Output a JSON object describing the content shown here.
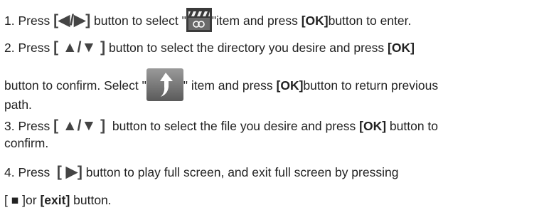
{
  "step1": {
    "prefix": "1. Press ",
    "key": "[◀/▶]",
    "mid": " button to select \"",
    "icon": "clapperboard-icon",
    "after_icon": "\"item and press ",
    "ok": "[OK]",
    "suffix": "button to enter."
  },
  "step2": {
    "prefix": "2. Press ",
    "key": "[ ▲/▼ ]",
    "mid": " button to select the directory you desire and press ",
    "ok": "[OK]",
    "line2_a": "button to confirm. Select \"",
    "icon": "return-arrow-icon",
    "line2_b": "\" item and press ",
    "ok2": "[OK]",
    "line2_c": "button to return previous",
    "line3": "path."
  },
  "step3": {
    "prefix": "3. Press ",
    "key": "[ ▲/▼ ]",
    "mid": "  button to select the file you desire and press ",
    "ok": "[OK]",
    "suffix": " button to",
    "line2": "confirm."
  },
  "step4": {
    "prefix": "4. Press  ",
    "key": "[ ▶]",
    "mid": " button to play full screen, and exit full screen by pressing",
    "key2": "[ ■ ]",
    "or": "or ",
    "exit": "[exit]",
    "suffix": " button."
  }
}
